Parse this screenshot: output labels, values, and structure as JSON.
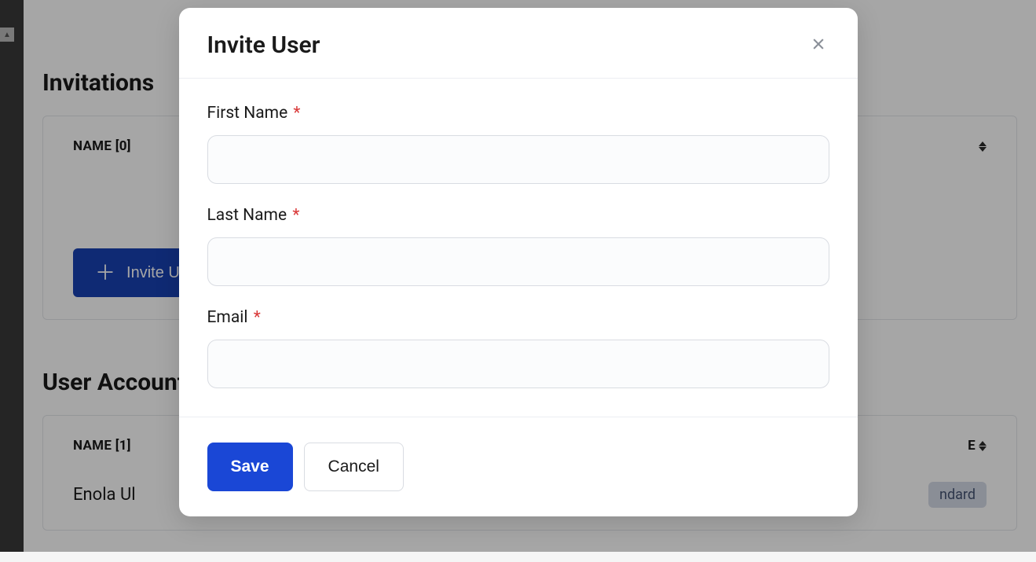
{
  "page": {
    "invitations_heading": "Invitations",
    "user_accounts_heading": "User Accounts"
  },
  "invitations_table": {
    "name_header": "NAME [0]"
  },
  "invite_button_label": "Invite User",
  "user_accounts_table": {
    "name_header": "NAME [1]",
    "role_header_suffix": "E"
  },
  "users": {
    "row0": {
      "name_prefix": "Enola Ul",
      "role_suffix": "ndard"
    }
  },
  "modal": {
    "title": "Invite User",
    "first_name_label": "First Name",
    "last_name_label": "Last Name",
    "email_label": "Email",
    "required_marker": "*",
    "first_name_value": "",
    "last_name_value": "",
    "email_value": "",
    "save_label": "Save",
    "cancel_label": "Cancel"
  }
}
